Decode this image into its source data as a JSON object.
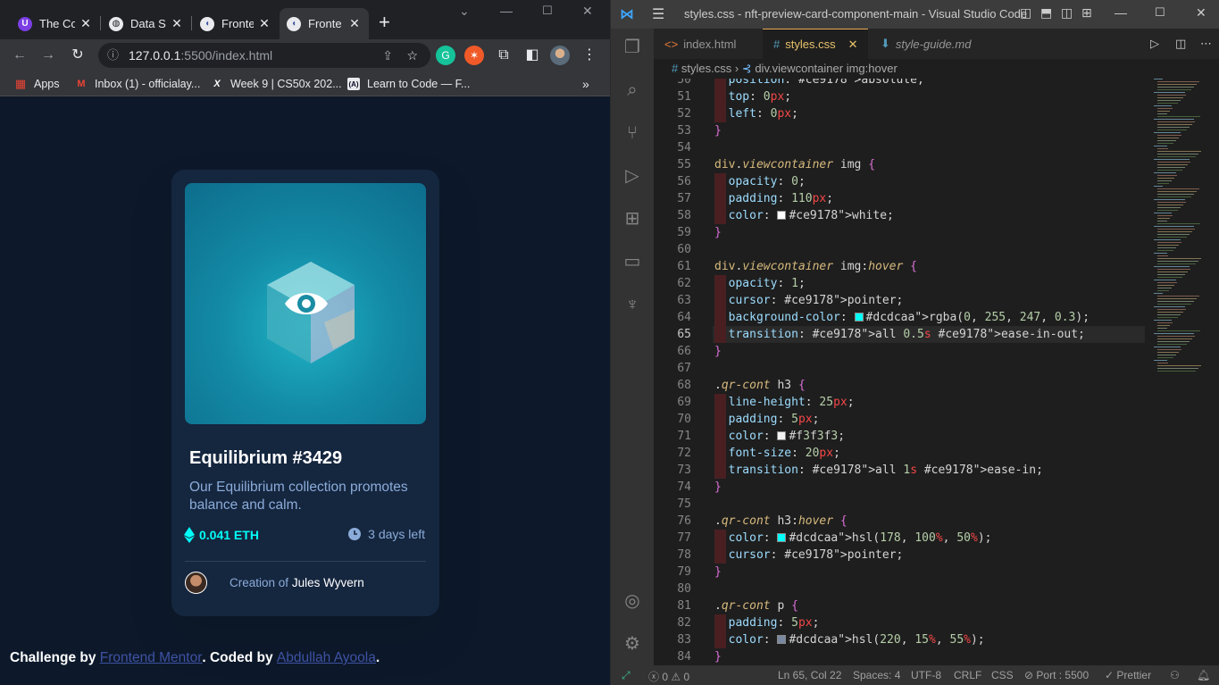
{
  "browser": {
    "tabs": [
      {
        "title": "The Co",
        "icon": "purple-badge-icon"
      },
      {
        "title": "Data Sc",
        "icon": "globe-icon"
      },
      {
        "title": "Fronte",
        "icon": "frontend-mentor-icon"
      },
      {
        "title": "Fronte",
        "icon": "frontend-mentor-icon"
      }
    ],
    "url_host": "127.0.0.1",
    "url_rest": ":5500/index.html",
    "bookmarks": [
      {
        "label": "Apps"
      },
      {
        "label": "Inbox (1) - officialay..."
      },
      {
        "label": "Week 9 | CS50x 202..."
      },
      {
        "label": "Learn to Code — F..."
      }
    ]
  },
  "page": {
    "card": {
      "title": "Equilibrium #3429",
      "description": "Our Equilibrium collection promotes balance and calm.",
      "price": "0.041 ETH",
      "days_left": "3 days left",
      "creation_prefix": "Creation of",
      "creator": "Jules Wyvern"
    },
    "attribution": {
      "prefix": "Challenge by",
      "link1": "Frontend Mentor",
      "mid": ". Coded by",
      "link2": "Abdullah Ayoola",
      "suffix": "."
    }
  },
  "vscode": {
    "window_title": "styles.css - nft-preview-card-component-main - Visual Studio Code",
    "tabs": [
      {
        "label": "index.html",
        "icon": "html-icon"
      },
      {
        "label": "styles.css",
        "icon": "css-icon"
      },
      {
        "label": "style-guide.md",
        "icon": "markdown-icon"
      }
    ],
    "breadcrumb": {
      "file": "styles.css",
      "selector": "div.viewcontainer img:hover"
    },
    "current_line": 65,
    "first_line": 50,
    "lines": [
      "  position: absolute;",
      "  top: 0px;",
      "  left: 0px;",
      "}",
      "",
      "div.viewcontainer img {",
      "  opacity: 0;",
      "  padding: 110px;",
      "  color: ■white;",
      "}",
      "",
      "div.viewcontainer img:hover {",
      "  opacity: 1;",
      "  cursor: pointer;",
      "  background-color: ■rgba(0, 255, 247, 0.3);",
      "  transition: all 0.5s ease-in-out;",
      "}",
      "",
      ".qr-cont h3 {",
      "  line-height: 25px;",
      "  padding: 5px;",
      "  color: ■#f3f3f3;",
      "  font-size: 20px;",
      "  transition: all 1s ease-in;",
      "}",
      "",
      ".qr-cont h3:hover {",
      "  color: ■hsl(178, 100%, 50%);",
      "  cursor: pointer;",
      "}",
      "",
      ".qr-cont p {",
      "  padding: 5px;",
      "  color: ■hsl(220, 15%, 55%);",
      "}"
    ],
    "swatch_colors": {
      "white": "#ffffff",
      "cyan": "#00fff7",
      "offwhite": "#f3f3f3",
      "teal": "#00fff8",
      "gray": "#7b88a1"
    },
    "status": {
      "errors": "0",
      "warnings": "0",
      "position": "Ln 65, Col 22",
      "spaces": "Spaces: 4",
      "encoding": "UTF-8",
      "eol": "CRLF",
      "language": "CSS",
      "port": "Port : 5500",
      "prettier": "Prettier"
    }
  }
}
